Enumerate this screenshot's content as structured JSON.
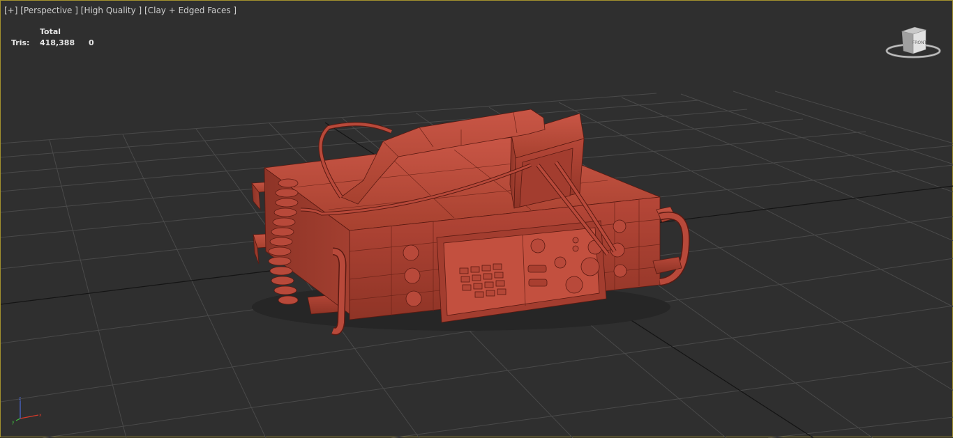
{
  "viewport": {
    "labels": {
      "plus": "[+]",
      "view": "[Perspective ]",
      "quality": "[High Quality ]",
      "shading": "[Clay + Edged Faces ]"
    },
    "stats": {
      "header": "Total",
      "tris_label": "Tris:",
      "tris_total": "418,388",
      "tris_selected": "0"
    },
    "viewcube": {
      "face_label": "FRONT"
    },
    "axes": {
      "x": "x",
      "y": "y",
      "z": "z"
    },
    "colors": {
      "background": "#2f2f2f",
      "grid": "#4a4a4a",
      "grid_axis": "#141414",
      "model_clay": "#b84a3c",
      "active_border": "#a3922e"
    }
  }
}
